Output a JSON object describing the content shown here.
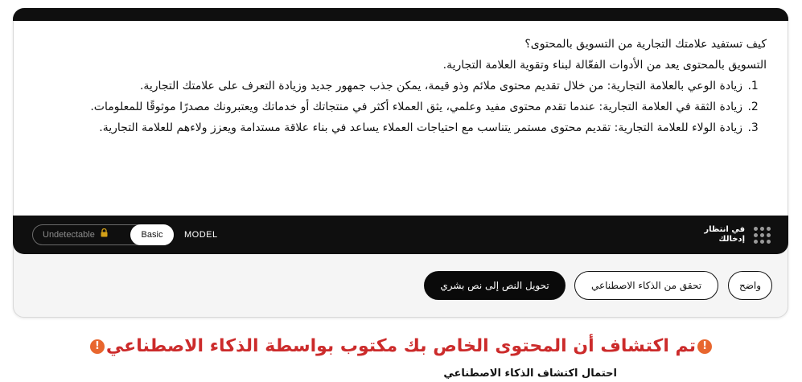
{
  "editor": {
    "question": "كيف تستفيد علامتك التجارية من التسويق بالمحتوى؟",
    "intro": "التسويق بالمحتوى يعد من الأدوات الفعّالة لبناء وتقوية العلامة التجارية.",
    "points": [
      "زيادة الوعي بالعلامة التجارية: من خلال تقديم محتوى ملائم وذو قيمة، يمكن جذب جمهور جديد وزيادة التعرف على علامتك التجارية.",
      "زيادة الثقة في العلامة التجارية: عندما تقدم محتوى مفيد وعلمي، يثق العملاء أكثر في منتجاتك أو خدماتك ويعتبرونك مصدرًا موثوقًا للمعلومات.",
      "زيادة الولاء للعلامة التجارية: تقديم محتوى مستمر يتناسب مع احتياجات العملاء يساعد في بناء علاقة مستدامة ويعزز ولاءهم للعلامة التجارية."
    ]
  },
  "toolbar": {
    "mode_undetectable": "Undetectable",
    "mode_basic": "Basic",
    "model_label": "MODEL",
    "status_line1": "في انتظار",
    "status_line2": "إدخالك"
  },
  "actions": {
    "humanize": "تحويل النص إلى نص بشري",
    "check_ai": "تحقق من الذكاء الاصطناعي",
    "clear": "واضح"
  },
  "result": {
    "heading": "تم اكتشاف أن المحتوى الخاص بك مكتوب بواسطة الذكاء الاصطناعي",
    "subtext": "احتمال اكتشاف الذكاء الاصطناعي"
  },
  "colors": {
    "toolbar_bg": "#0f0f0f",
    "warning_red": "#cc2b2b",
    "warning_icon": "#e8662e",
    "lock": "#d4a017"
  },
  "icons": {
    "lock": "lock-icon",
    "menu": "grid-dots-icon",
    "warning": "warning-icon"
  }
}
